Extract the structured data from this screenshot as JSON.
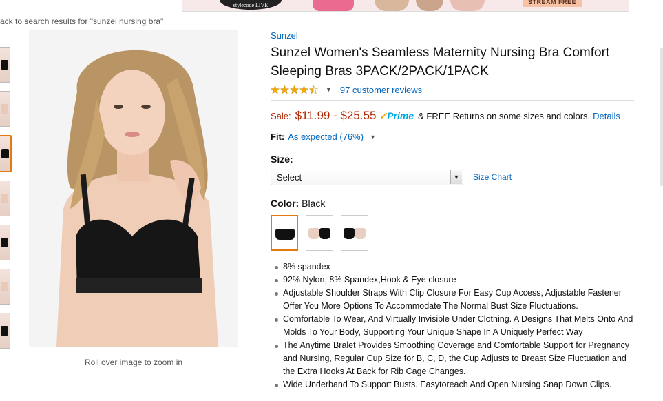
{
  "banner": {
    "logo_text": "stylecode LIVE",
    "cta_label": "STREAM FREE"
  },
  "back_link": "ack to search results for \"sunzel nursing bra\"",
  "zoom_note": "Roll over image to zoom in",
  "product": {
    "brand": "Sunzel",
    "title": "Sunzel Women's Seamless Maternity Nursing Bra Comfort Sleeping Bras 3PACK/2PACK/1PACK",
    "rating": 4.5,
    "reviews_label": "97 customer reviews",
    "sale_label": "Sale:",
    "price": "$11.99 - $25.55",
    "prime_label": "Prime",
    "returns_text": "& FREE Returns on some sizes and colors.",
    "details_label": "Details",
    "fit_label": "Fit:",
    "fit_value": "As expected (76%)",
    "size_label": "Size:",
    "size_select_value": "Select",
    "size_chart_label": "Size Chart",
    "color_label": "Color:",
    "color_value": "Black",
    "bullets": [
      "8% spandex",
      "92% Nylon, 8% Spandex,Hook & Eye closure",
      "Adjustable Shoulder Straps With Clip Closure For Easy Cup Access, Adjustable Fastener Offer You More Options To Accommodate The Normal Bust Size Fluctuations.",
      "Comfortable To Wear, And Virtually Invisible Under Clothing. A Designs That Melts Onto And Molds To Your Body, Supporting Your Unique Shape In A Uniquely Perfect Way",
      "The Anytime Bralet Provides Smoothing Coverage and Comfortable Support for Pregnancy and Nursing, Regular Cup Size for B, C, D, the Cup Adjusts to Breast Size Fluctuation and the Extra Hooks At Back for Rib Cage Changes.",
      "Wide Underband To Support Busts. Easytoreach And Open Nursing Snap Down Clips."
    ]
  },
  "colors": {
    "link": "#0066c0",
    "price": "#b12704",
    "star": "#f4a700",
    "selected_border": "#e47911"
  },
  "icons": {
    "star": "star-icon",
    "prime_check": "prime-check-icon",
    "dropdown": "chevron-down-icon"
  }
}
